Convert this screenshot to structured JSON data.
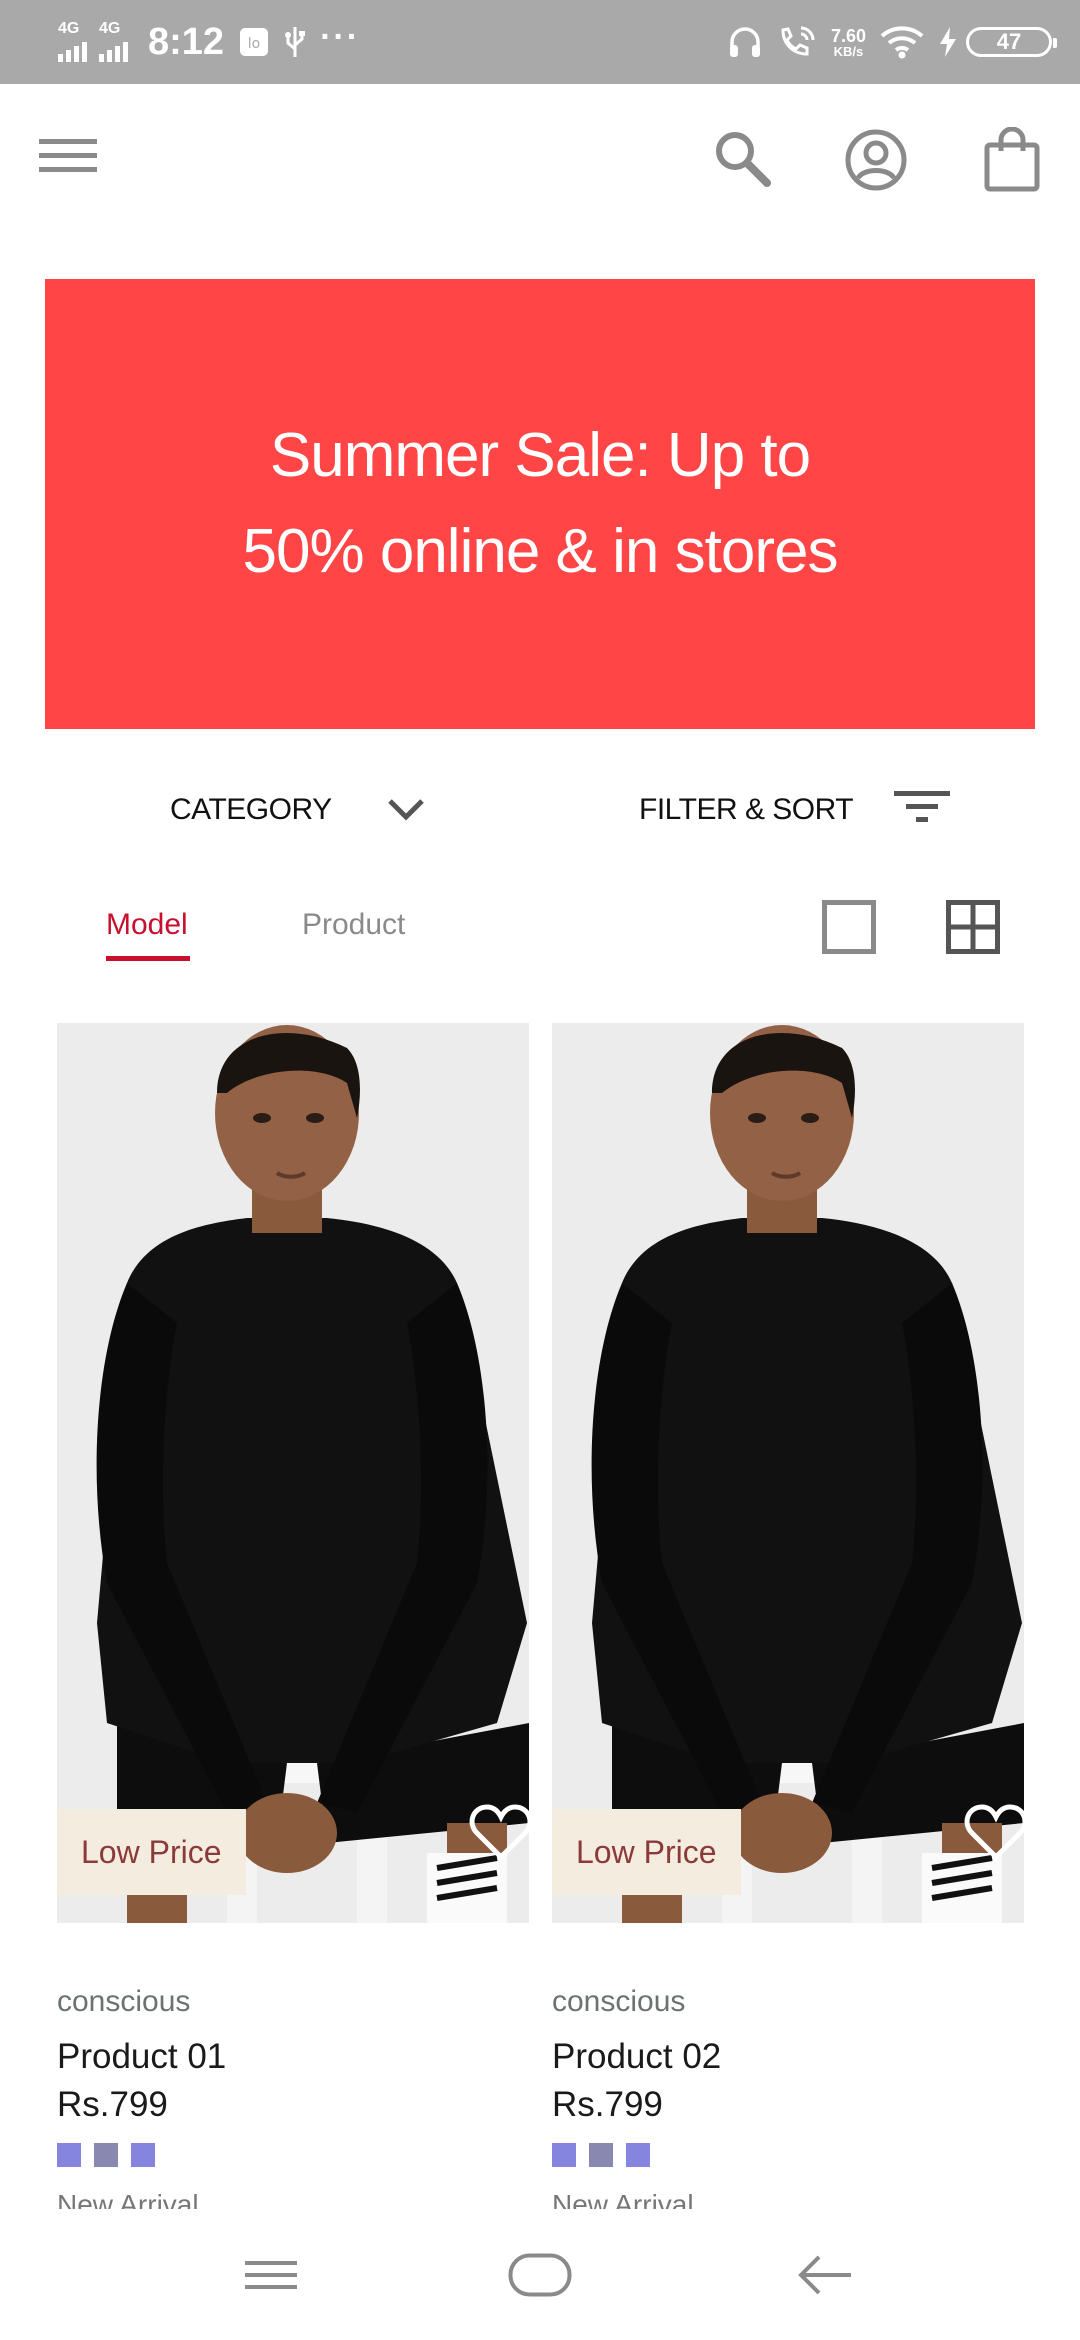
{
  "status_bar": {
    "network_1": "4G",
    "network_2": "4G",
    "time": "8:12",
    "more": "···",
    "speed_value": "7.60",
    "speed_unit": "KB/s",
    "battery": "47"
  },
  "banner": {
    "text": "Summer Sale: Up to 50% online & in stores",
    "background": "#ff4545"
  },
  "filters": {
    "category_label": "CATEGORY",
    "filter_sort_label": "FILTER & SORT"
  },
  "tabs": [
    {
      "label": "Model",
      "active": true
    },
    {
      "label": "Product",
      "active": false
    }
  ],
  "accent_color": "#c8102e",
  "products": [
    {
      "badge": "Low Price",
      "brand": "conscious",
      "name": "Product 01",
      "price": "Rs.799",
      "swatches": [
        "#8585e0",
        "#8888b0",
        "#8585e0"
      ],
      "tag": "New Arrival"
    },
    {
      "badge": "Low Price",
      "brand": "conscious",
      "name": "Product 02",
      "price": "Rs.799",
      "swatches": [
        "#8585e0",
        "#8888b0",
        "#8585e0"
      ],
      "tag": "New Arrival"
    }
  ],
  "icons": {
    "menu": "hamburger-menu-icon",
    "search": "search-icon",
    "account": "account-icon",
    "bag": "shopping-bag-icon",
    "category_chevron": "chevron-down-icon",
    "filter": "filter-icon",
    "single_view": "single-view-icon",
    "grid_view": "grid-view-icon",
    "wishlist": "heart-icon"
  }
}
